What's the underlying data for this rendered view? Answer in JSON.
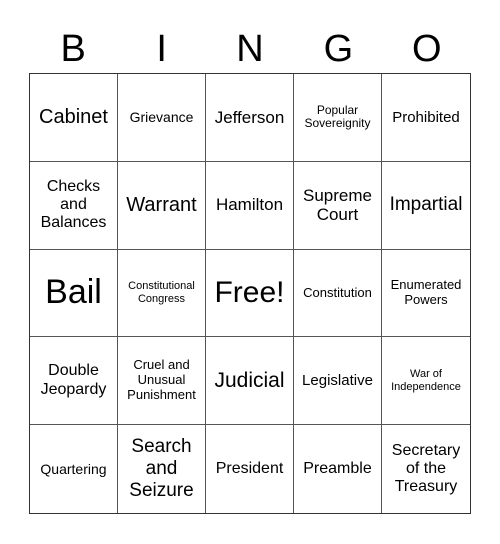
{
  "header": {
    "letters": [
      "B",
      "I",
      "N",
      "G",
      "O"
    ]
  },
  "cells": [
    "Cabinet",
    "Grievance",
    "Jefferson",
    "Popular Sovereignity",
    "Prohibited",
    "Checks and Balances",
    "Warrant",
    "Hamilton",
    "Supreme Court",
    "Impartial",
    "Bail",
    "Constitutional Congress",
    "Free!",
    "Constitution",
    "Enumerated Powers",
    "Double Jeopardy",
    "Cruel and Unusual Punishment",
    "Judicial",
    "Legislative",
    "War of Independence",
    "Quartering",
    "Search and Seizure",
    "President",
    "Preamble",
    "Secretary of the Treasury"
  ]
}
